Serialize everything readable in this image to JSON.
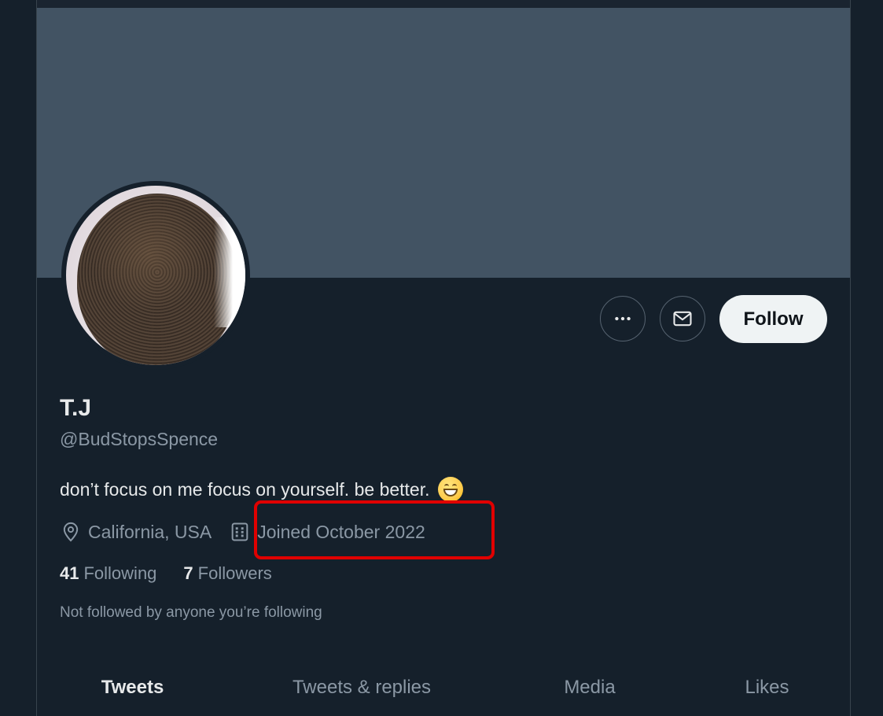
{
  "profile": {
    "name": "T.J",
    "handle": "@BudStopsSpence",
    "bio": "don’t focus on me focus on yourself. be better.",
    "bio_emoji": "grinning-face-with-smiling-eyes",
    "location": "California, USA",
    "joined": "Joined October 2022",
    "following_count": "41",
    "following_label": "Following",
    "followers_count": "7",
    "followers_label": "Followers",
    "mutuals_note": "Not followed by anyone you’re following"
  },
  "actions": {
    "more_icon": "more-horizontal-icon",
    "message_icon": "envelope-icon",
    "follow_label": "Follow"
  },
  "tabs": [
    {
      "label": "Tweets",
      "active": true
    },
    {
      "label": "Tweets & replies",
      "active": false
    },
    {
      "label": "Media",
      "active": false
    },
    {
      "label": "Likes",
      "active": false
    }
  ],
  "colors": {
    "background": "#15202b",
    "banner": "#425363",
    "highlight": "#e00000",
    "primary_text": "#e7e9ea",
    "secondary_text": "#8b98a5"
  }
}
